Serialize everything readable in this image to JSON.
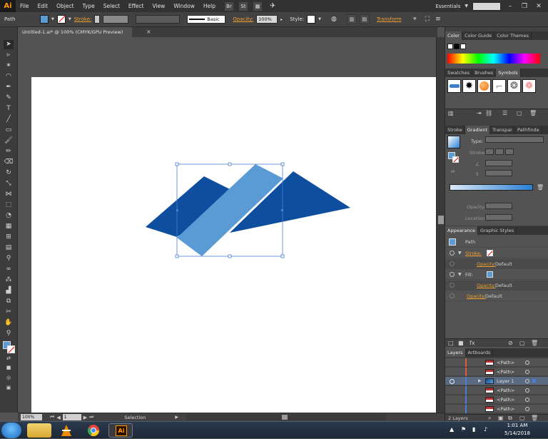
{
  "colors": {
    "dark_blue": "#0d4f9e",
    "light_blue": "#5b9bd5",
    "selection": "#4a7fd6",
    "accent_orange": "#f0a030"
  },
  "menubar": {
    "logo": "Ai",
    "items": [
      "File",
      "Edit",
      "Object",
      "Type",
      "Select",
      "Effect",
      "View",
      "Window",
      "Help"
    ],
    "br_label": "Br",
    "st_label": "St",
    "workspace": "Essentials",
    "minimize": "–",
    "maximize": "❐",
    "close": "✕"
  },
  "control": {
    "selection_type": "Path",
    "stroke_label": "Stroke:",
    "profile": "Basic",
    "opacity_label": "Opacity:",
    "opacity_value": "100%",
    "style_label": "Style:",
    "transform_label": "Transform"
  },
  "document": {
    "tab_title": "Untitled-1.ai* @ 100% (CMYK/GPU Preview)",
    "close": "×"
  },
  "status": {
    "zoom": "100%",
    "artboard_number": "1",
    "tool_label": "Selection"
  },
  "color_panel": {
    "tabs": [
      "Color",
      "Color Guide",
      "Color Themes"
    ]
  },
  "symbols_panel": {
    "tabs": [
      "Swatches",
      "Brushes",
      "Symbols"
    ],
    "symbols": [
      "blue-brush-symbol",
      "black-splatter-symbol",
      "orange-sphere-symbol",
      "gray-scroll-symbol",
      "gray-ring-symbol",
      "pink-flower-symbol"
    ]
  },
  "gradient_panel": {
    "tabs": [
      "Stroke",
      "Gradient",
      "Transpar",
      "Pathfinde"
    ],
    "type_label": "Type:",
    "stroke_label": "Stroke:",
    "opacity_label": "Opacity:",
    "location_label": "Location:"
  },
  "appearance_panel": {
    "tabs": [
      "Appearance",
      "Graphic Styles"
    ],
    "object_label": "Path",
    "stroke_label": "Stroke:",
    "opacity_label": "Opacity:",
    "opacity_value": "Default",
    "fill_label": "Fill:"
  },
  "layers_panel": {
    "tabs": [
      "Layers",
      "Artboards"
    ],
    "rows": [
      "<Path>",
      "<Path>",
      "Layer 1",
      "<Path>",
      "<Path>",
      "<Path>"
    ],
    "count": "2 Layers"
  },
  "taskbar": {
    "time": "1:01 AM",
    "date": "5/14/2018"
  }
}
